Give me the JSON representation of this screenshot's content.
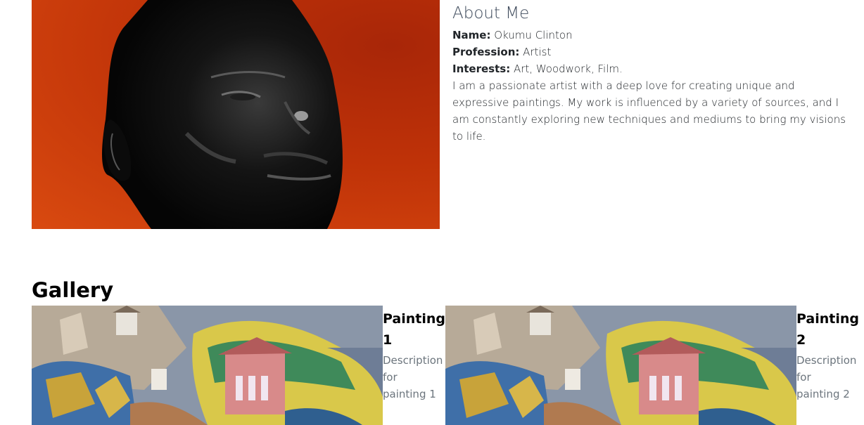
{
  "portrait": {
    "alt": "Portrait of Okumu Clinton"
  },
  "about": {
    "title": "About Me",
    "name_label": "Name:",
    "name_value": "Okumu Clinton",
    "profession_label": "Profession:",
    "profession_value": "Artist",
    "interests_label": "Interests:",
    "interests_value": "Art, Woodwork, Film.",
    "bio": "I am a passionate artist with a deep love for creating unique and expressive paintings. My work is influenced by a variety of sources, and I am constantly exploring new techniques and mediums to bring my visions to life."
  },
  "gallery": {
    "title": "Gallery",
    "items": [
      {
        "title": "Painting 1",
        "description": "Description for painting 1"
      },
      {
        "title": "Painting 2",
        "description": "Description for painting 2"
      }
    ]
  },
  "colors": {
    "portrait_bg": "#c23a0b",
    "heading": "#3f4b5c",
    "muted": "#6c757d"
  }
}
